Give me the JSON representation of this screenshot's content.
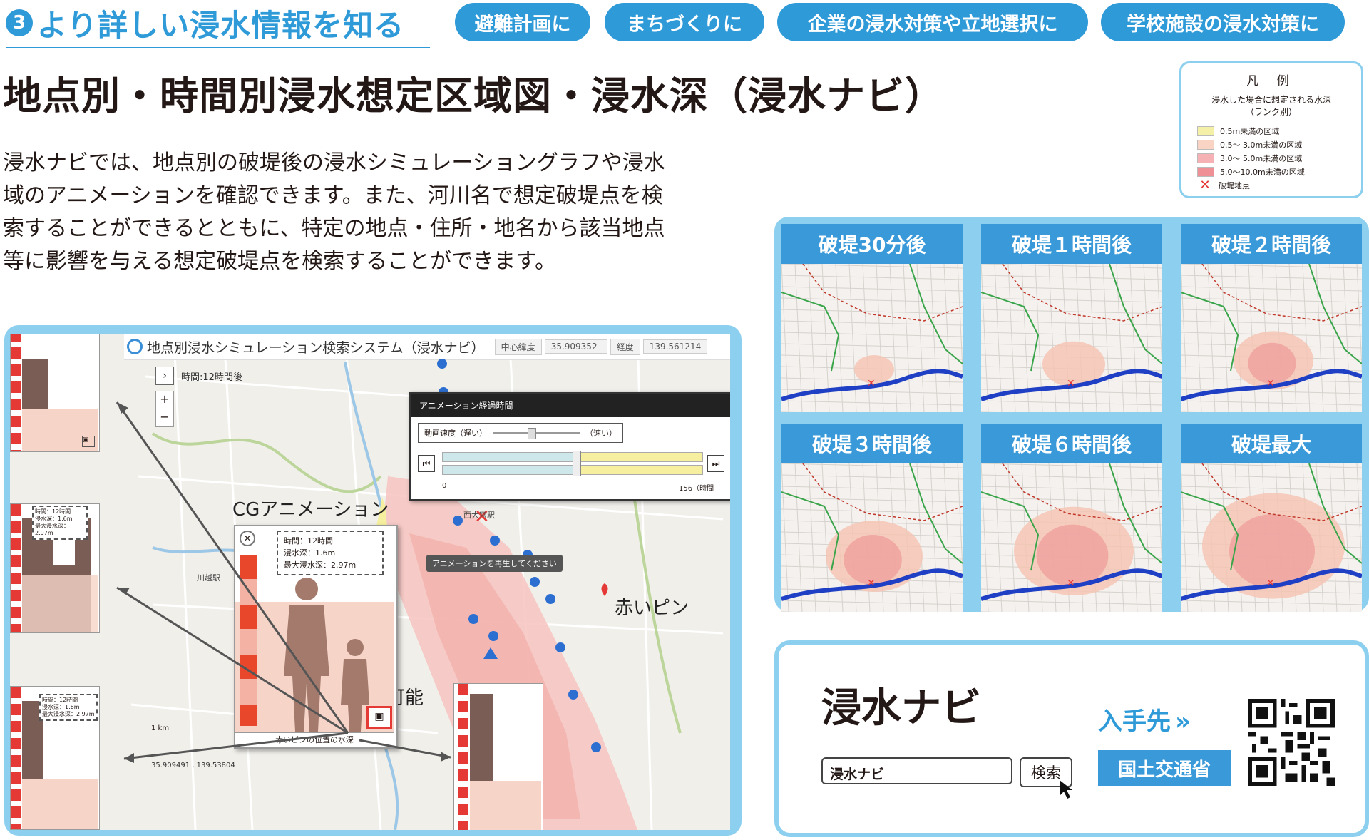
{
  "section": {
    "number": "3",
    "title": "より詳しい浸水情報を知る"
  },
  "tags": [
    "避難計画に",
    "まちづくりに",
    "企業の浸水対策や立地選択に",
    "学校施設の浸水対策に"
  ],
  "page_title": "地点別・時間別浸水想定区域図・浸水深（浸水ナビ）",
  "description": [
    "浸水ナビでは、地点別の破堤後の浸水シミュレーショングラフや浸水",
    "域のアニメーションを確認できます。また、河川名で想定破堤点を検",
    "索することができるとともに、特定の地点・住所・地名から該当地点",
    "等に影響を与える想定破堤点を検索することができます。"
  ],
  "legend": {
    "title": "凡 例",
    "subtitle_line1": "浸水した場合に想定される水深",
    "subtitle_line2": "（ランク別）",
    "items": [
      {
        "label": "0.5m未満の区域",
        "color": "#f5f0a8"
      },
      {
        "label": "0.5～ 3.0m未満の区域",
        "color": "#f9d3c3"
      },
      {
        "label": "3.0～ 5.0m未満の区域",
        "color": "#f5b1b3"
      },
      {
        "label": "5.0～10.0m未満の区域",
        "color": "#ef8f96"
      }
    ],
    "breach_label": "破堤地点"
  },
  "map_tiles": [
    {
      "label": "破堤30分後",
      "level": 0.1
    },
    {
      "label": "破堤１時間後",
      "level": 0.3
    },
    {
      "label": "破堤２時間後",
      "level": 0.45
    },
    {
      "label": "破堤３時間後",
      "level": 0.6
    },
    {
      "label": "破堤６時間後",
      "level": 0.8
    },
    {
      "label": "破堤最大",
      "level": 1.0
    }
  ],
  "screenshot": {
    "app_title": "地点別浸水シミュレーション検索システム（浸水ナビ）",
    "center_lat_label": "中心緯度",
    "center_lat": "35.909352",
    "lon_label": "経度",
    "lon": "139.561214",
    "time_label": "時間:12時間後",
    "anim_title": "アニメーション経過時間",
    "speed_label": "動画速度（遅い）",
    "speed_fast": "（速い）",
    "timeline_start": "0",
    "timeline_end": "156（時間",
    "play_hint": "アニメーションを再生してください",
    "station1": "西大宮駅",
    "station2": "川越駅",
    "scale": "1 km",
    "coords": "35.909491 , 139.53804",
    "cg_label": "CGアニメーション",
    "red_pin_label": "赤いピン",
    "switch_label": "切替可能",
    "cg_info": {
      "time": "時間：12時間",
      "depth": "浸水深：1.6m",
      "max": "最大浸水深：2.97m"
    },
    "cg_caption": "赤いピンの位置の水深",
    "small_info1": {
      "a": "時間：12時間",
      "b": "浸水深：1.6m",
      "c": "最大浸水深：2.97m"
    },
    "small_info2": {
      "a": "時間：12時間",
      "b": "浸水深：1.6m",
      "c": "最大浸水深：2.97m"
    }
  },
  "navi": {
    "title": "浸水ナビ",
    "search_value": "浸水ナビ",
    "search_button": "検索",
    "get_label": "入手先",
    "get_arrows": "»",
    "provider": "国土交通省"
  }
}
